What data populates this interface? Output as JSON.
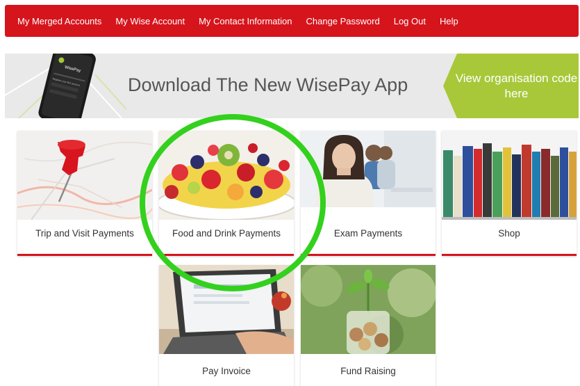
{
  "nav": {
    "items": [
      "My Merged Accounts",
      "My Wise Account",
      "My Contact Information",
      "Change Password",
      "Log Out",
      "Help"
    ]
  },
  "banner": {
    "title": "Download The New WisePay App",
    "cta": "View organisation code here",
    "phone_logo": "WisePay",
    "phone_text": "Register your first account"
  },
  "tiles": [
    {
      "label": "Trip and Visit Payments",
      "icon": "map-pin-icon"
    },
    {
      "label": "Food and Drink Payments",
      "icon": "fruit-bowl-image"
    },
    {
      "label": "Exam Payments",
      "icon": "students-image"
    },
    {
      "label": "Shop",
      "icon": "books-image"
    },
    {
      "label": "Pay Invoice",
      "icon": "laptop-image"
    },
    {
      "label": "Fund Raising",
      "icon": "coin-jar-image"
    }
  ],
  "colors": {
    "brand_red": "#d6141c",
    "banner_green": "#a8c83a",
    "highlight_green": "#33d11d"
  }
}
